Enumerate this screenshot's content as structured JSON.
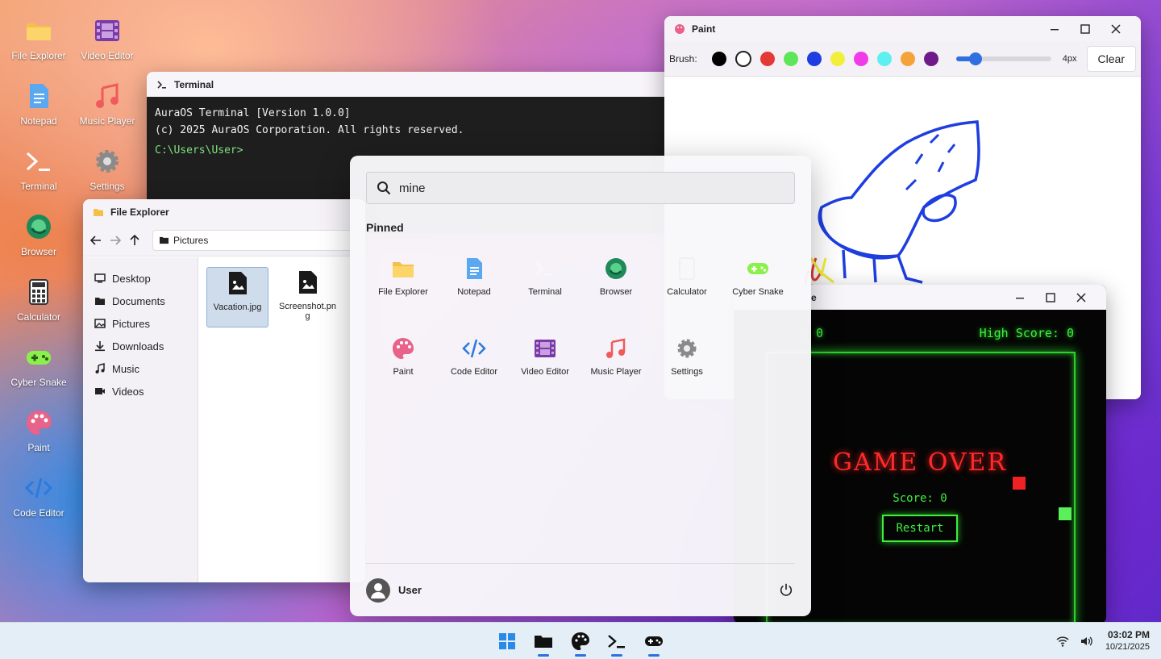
{
  "desktop": {
    "icons": [
      {
        "label": "File Explorer",
        "icon": "folder-icon"
      },
      {
        "label": "Video Editor",
        "icon": "film-icon"
      },
      {
        "label": "Notepad",
        "icon": "notepad-icon"
      },
      {
        "label": "Music Player",
        "icon": "music-note-icon"
      },
      {
        "label": "Terminal",
        "icon": "terminal-icon"
      },
      {
        "label": "Settings",
        "icon": "gear-icon"
      },
      {
        "label": "Browser",
        "icon": "browser-icon"
      },
      {
        "label": "Calculator",
        "icon": "calculator-icon"
      },
      {
        "label": "Cyber Snake",
        "icon": "gamepad-icon"
      },
      {
        "label": "Paint",
        "icon": "palette-icon"
      },
      {
        "label": "Code Editor",
        "icon": "code-icon"
      }
    ]
  },
  "terminal": {
    "title": "Terminal",
    "lines": [
      "AuraOS Terminal [Version 1.0.0]",
      "(c) 2025 AuraOS Corporation. All rights reserved."
    ],
    "prompt": "C:\\Users\\User>"
  },
  "paint": {
    "title": "Paint",
    "brush_label": "Brush:",
    "colors": [
      "#000000",
      "#ffffff",
      "#e53935",
      "#5ee65a",
      "#1e3ee0",
      "#f2ee3c",
      "#f03ce8",
      "#5ef0f0",
      "#f5a23a",
      "#6e1a8a"
    ],
    "selected_color": "#ffffff",
    "brush_size_label": "4px",
    "brush_size_fraction": 0.2,
    "clear_label": "Clear"
  },
  "snake": {
    "title_fragment": "e",
    "score_fragment": ": 0",
    "high_score": "High Score: 0",
    "game_over": "GAME OVER",
    "final_score": "Score: 0",
    "restart_label": "Restart",
    "accent": "#3cf03c"
  },
  "explorer": {
    "title": "File Explorer",
    "path": "Pictures",
    "sidebar": [
      {
        "label": "Desktop",
        "icon": "monitor-icon"
      },
      {
        "label": "Documents",
        "icon": "folder-icon"
      },
      {
        "label": "Pictures",
        "icon": "image-icon"
      },
      {
        "label": "Downloads",
        "icon": "download-icon"
      },
      {
        "label": "Music",
        "icon": "music-note-icon"
      },
      {
        "label": "Videos",
        "icon": "video-icon"
      }
    ],
    "files": [
      {
        "name": "Vacation.jpg",
        "selected": true
      },
      {
        "name": "Screenshot.png",
        "selected": false
      }
    ]
  },
  "start_menu": {
    "search_value": "mine",
    "pinned_title": "Pinned",
    "apps": [
      {
        "label": "File Explorer",
        "icon": "folder-icon"
      },
      {
        "label": "Notepad",
        "icon": "notepad-icon"
      },
      {
        "label": "Terminal",
        "icon": "terminal-icon"
      },
      {
        "label": "Browser",
        "icon": "browser-icon"
      },
      {
        "label": "Calculator",
        "icon": "calculator-icon"
      },
      {
        "label": "Cyber Snake",
        "icon": "gamepad-icon"
      },
      {
        "label": "Paint",
        "icon": "palette-icon"
      },
      {
        "label": "Code Editor",
        "icon": "code-icon"
      },
      {
        "label": "Video Editor",
        "icon": "film-icon"
      },
      {
        "label": "Music Player",
        "icon": "music-note-icon"
      },
      {
        "label": "Settings",
        "icon": "gear-icon"
      }
    ],
    "user": "User"
  },
  "taskbar": {
    "items": [
      "start-icon",
      "folder-icon",
      "palette-icon",
      "terminal-icon",
      "gamepad-icon"
    ],
    "time": "03:02 PM",
    "date": "10/21/2025"
  }
}
